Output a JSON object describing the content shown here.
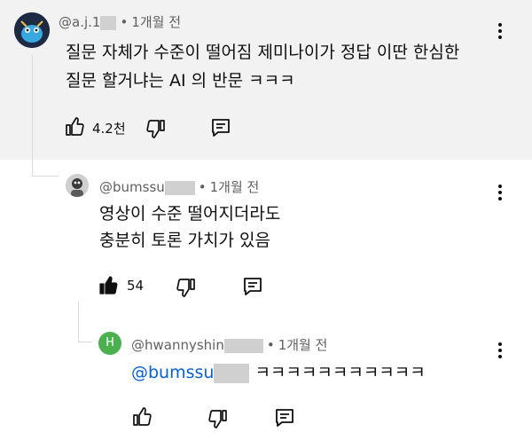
{
  "comments": [
    {
      "handle": "@a.j.1",
      "time": "1개월 전",
      "text_line1": "질문 자체가 수준이 떨어짐 제미나이가 정답 이딴 한심한",
      "text_line2": "질문 할거냐는 AI 의 반문 ㅋㅋㅋ",
      "likes": "4.2천"
    },
    {
      "handle": "@bumssu",
      "time": "1개월 전",
      "text_line1": "영상이 수준 떨어지더라도",
      "text_line2": "충분히 토론 가치가 있음",
      "likes": "54"
    },
    {
      "handle": "@hwannyshin",
      "avatar_letter": "H",
      "time": "1개월 전",
      "mention": "@bumssu",
      "text": "ㅋㅋㅋㅋㅋㅋㅋㅋㅋㅋㅋ"
    }
  ],
  "icons": {
    "like": "thumbs-up-icon",
    "dislike": "thumbs-down-icon",
    "reply": "reply-icon",
    "more": "more-vert-icon"
  }
}
